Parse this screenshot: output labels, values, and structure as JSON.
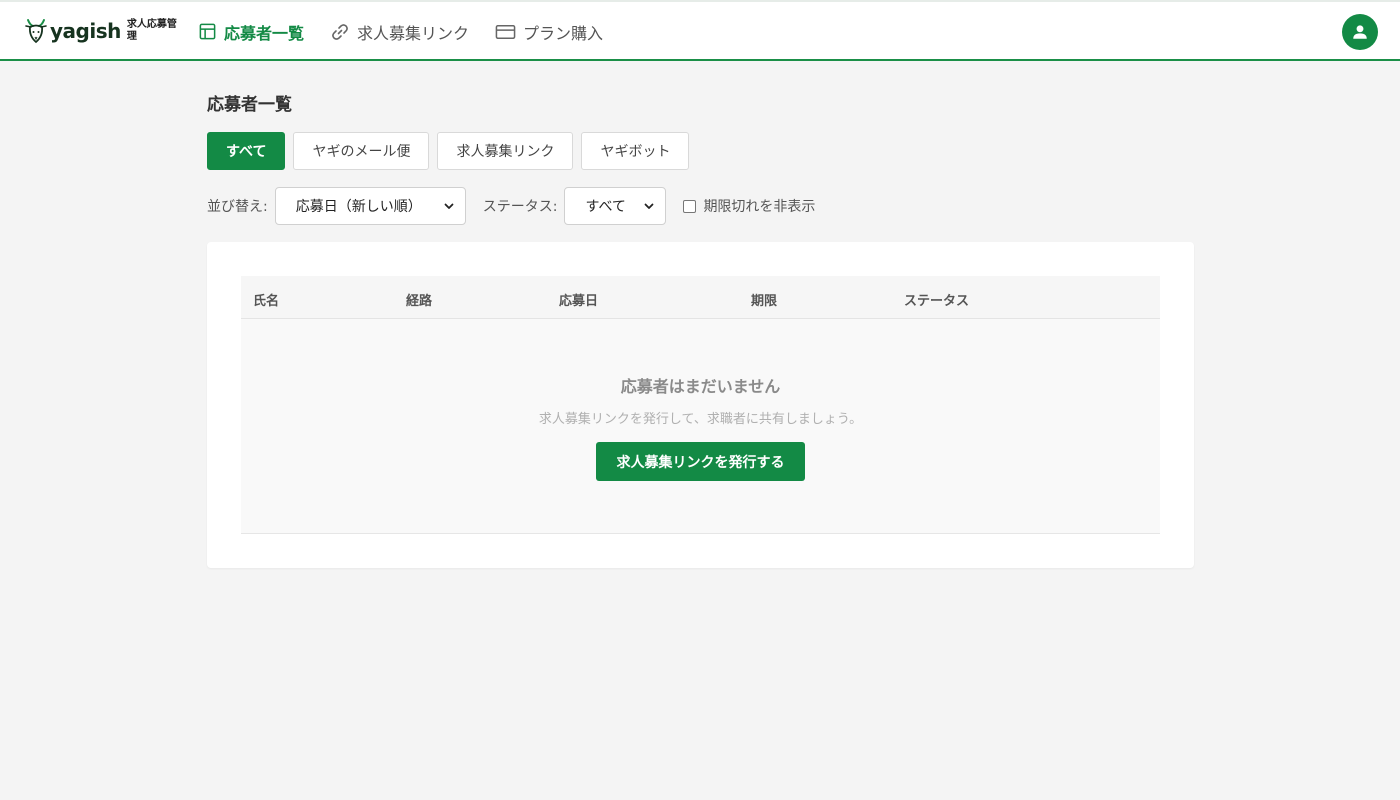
{
  "brand": {
    "name": "yagish",
    "subtitle": "求人応募管理",
    "accent_color": "#138a45"
  },
  "nav": {
    "items": [
      {
        "label": "応募者一覧",
        "icon": "layout-icon",
        "active": true
      },
      {
        "label": "求人募集リンク",
        "icon": "link-icon",
        "active": false
      },
      {
        "label": "プラン購入",
        "icon": "credit-card-icon",
        "active": false
      }
    ]
  },
  "page": {
    "title": "応募者一覧"
  },
  "tabs": [
    {
      "label": "すべて",
      "active": true
    },
    {
      "label": "ヤギのメール便",
      "active": false
    },
    {
      "label": "求人募集リンク",
      "active": false
    },
    {
      "label": "ヤギボット",
      "active": false
    }
  ],
  "filters": {
    "sort_label": "並び替え:",
    "sort_value": "応募日（新しい順）",
    "status_label": "ステータス:",
    "status_value": "すべて",
    "hide_expired_label": "期限切れを非表示",
    "hide_expired_checked": false
  },
  "table": {
    "columns": [
      "氏名",
      "経路",
      "応募日",
      "期限",
      "ステータス"
    ],
    "rows": []
  },
  "empty_state": {
    "title": "応募者はまだいません",
    "description": "求人募集リンクを発行して、求職者に共有しましょう。",
    "button_label": "求人募集リンクを発行する"
  }
}
